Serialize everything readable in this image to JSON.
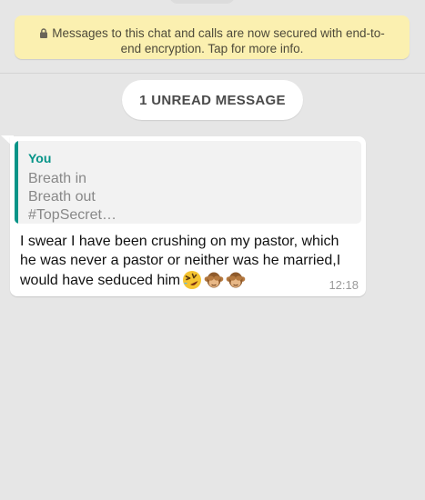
{
  "banner": {
    "icon": "lock-icon",
    "text": "Messages to this chat and calls are now secured with end-to-end encryption. Tap for more info."
  },
  "unread": {
    "label": "1 UNREAD MESSAGE"
  },
  "message": {
    "quote": {
      "author": "You",
      "lines": [
        "Breath in",
        "Breath out",
        "#TopSecret…"
      ]
    },
    "text": "I swear I have been crushing on my pastor, which he was never a pastor or neither was he married,I would have seduced him",
    "emojis": [
      "rolling-laughing-emoji",
      "see-no-evil-monkey-emoji",
      "see-no-evil-monkey-emoji"
    ],
    "time": "12:18"
  },
  "colors": {
    "background": "#e6e6e6",
    "banner": "#fbf0b0",
    "quote_accent": "#069488",
    "bubble": "#ffffff"
  }
}
